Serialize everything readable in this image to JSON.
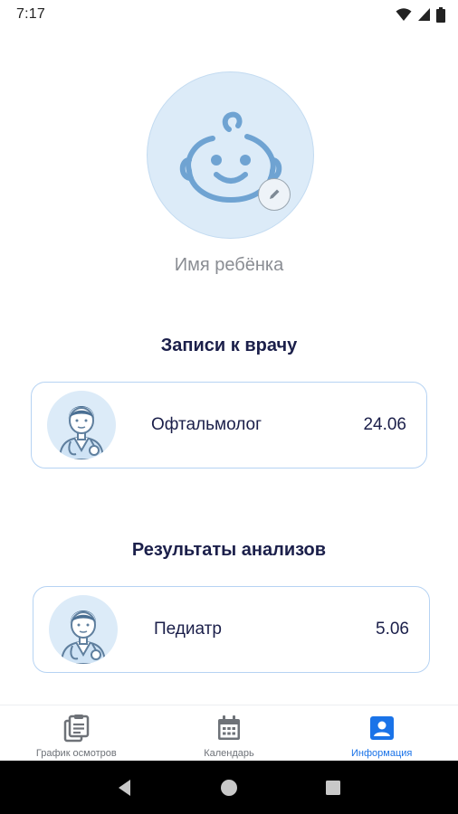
{
  "status_bar": {
    "time": "7:17"
  },
  "profile": {
    "child_name": "Имя ребёнка"
  },
  "appointments": {
    "title": "Записи к врачу",
    "items": [
      {
        "label": "Офтальмолог",
        "date": "24.06"
      }
    ]
  },
  "results": {
    "title": "Результаты анализов",
    "items": [
      {
        "label": "Педиатр",
        "date": "5.06"
      }
    ]
  },
  "bottom_nav": {
    "items": [
      {
        "label": "График осмотров",
        "icon": "clipboard-icon",
        "active": false
      },
      {
        "label": "Календарь",
        "icon": "calendar-icon",
        "active": false
      },
      {
        "label": "Информация",
        "icon": "account-box-icon",
        "active": true
      }
    ]
  },
  "colors": {
    "accent": "#1a73e8",
    "title": "#1b1f4a",
    "avatar_bg": "#dcebf8",
    "card_border": "#b6d3f3",
    "icon_blue": "#6fa3d2"
  }
}
